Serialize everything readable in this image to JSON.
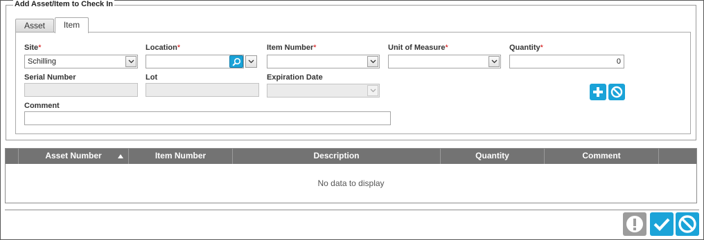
{
  "section": {
    "title": "Add Asset/Item to Check In"
  },
  "tabs": [
    {
      "label": "Asset",
      "active": false
    },
    {
      "label": "Item",
      "active": true
    }
  ],
  "form": {
    "site": {
      "label": "Site",
      "required_mark": "*",
      "value": "Schilling"
    },
    "location": {
      "label": "Location",
      "required_mark": "*",
      "value": ""
    },
    "item_number": {
      "label": "Item Number",
      "required_mark": "*",
      "value": ""
    },
    "unit_of_measure": {
      "label": "Unit of Measure",
      "required_mark": "*",
      "value": ""
    },
    "quantity": {
      "label": "Quantity",
      "required_mark": "*",
      "value": "0"
    },
    "serial_number": {
      "label": "Serial Number",
      "value": ""
    },
    "lot": {
      "label": "Lot",
      "value": ""
    },
    "expiration_date": {
      "label": "Expiration Date",
      "value": ""
    },
    "comment": {
      "label": "Comment",
      "value": ""
    }
  },
  "actions": {
    "add_icon": "plus-icon",
    "cancel_icon": "ban-icon"
  },
  "grid": {
    "columns": [
      {
        "label": "Asset Number",
        "sorted": "ascending"
      },
      {
        "label": "Item Number"
      },
      {
        "label": "Description"
      },
      {
        "label": "Quantity"
      },
      {
        "label": "Comment"
      }
    ],
    "empty_message": "No data to display"
  },
  "footer": {
    "warning_icon": "exclamation-icon",
    "confirm_icon": "checkmark-icon",
    "cancel_icon": "ban-icon"
  },
  "colors": {
    "accent": "#1aa3d8",
    "header_bg": "#737373",
    "required": "#d00000",
    "disabled_button": "#9c9c9c"
  }
}
